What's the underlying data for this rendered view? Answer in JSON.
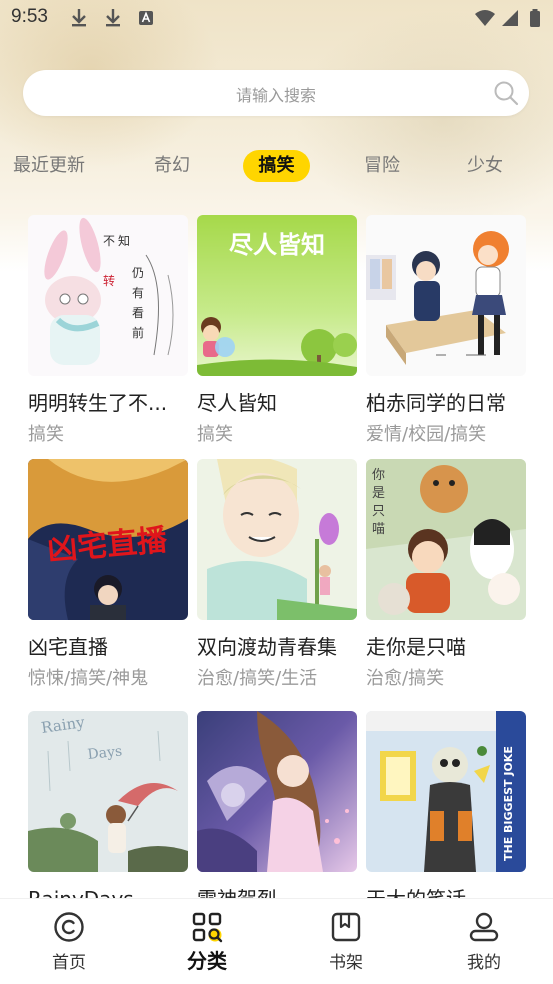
{
  "status_bar": {
    "time": "9:53"
  },
  "search": {
    "placeholder": "请输入搜索"
  },
  "tabs": [
    {
      "label": "最近更新",
      "active": false
    },
    {
      "label": "奇幻",
      "active": false
    },
    {
      "label": "搞笑",
      "active": true
    },
    {
      "label": "冒险",
      "active": false
    },
    {
      "label": "少女",
      "active": false
    }
  ],
  "comics": [
    {
      "title": "明明转生了不...",
      "tags": "搞笑"
    },
    {
      "title": "尽人皆知",
      "tags": "搞笑",
      "cover_text": "尽人皆知"
    },
    {
      "title": "柏赤同学的日常",
      "tags": "爱情/校园/搞笑"
    },
    {
      "title": "凶宅直播",
      "tags": "惊悚/搞笑/神鬼",
      "cover_text": "凶宅直播"
    },
    {
      "title": "双向渡劫青春集",
      "tags": "治愈/搞笑/生活"
    },
    {
      "title": "走你是只喵",
      "tags": "治愈/搞笑"
    },
    {
      "title": "RainyDays",
      "tags": "",
      "cover_text": "Rainy Days"
    },
    {
      "title": "雷神贺烈",
      "tags": ""
    },
    {
      "title": "天大的笑话",
      "tags": "",
      "cover_text": "THE BIGGEST JOKE"
    }
  ],
  "bottom_nav": [
    {
      "label": "首页",
      "icon": "home-icon",
      "active": false
    },
    {
      "label": "分类",
      "icon": "category-icon",
      "active": true
    },
    {
      "label": "书架",
      "icon": "bookshelf-icon",
      "active": false
    },
    {
      "label": "我的",
      "icon": "profile-icon",
      "active": false
    }
  ],
  "colors": {
    "accent": "#ffd500",
    "tab_inactive": "#777777",
    "tag_text": "#9a9a9a"
  }
}
